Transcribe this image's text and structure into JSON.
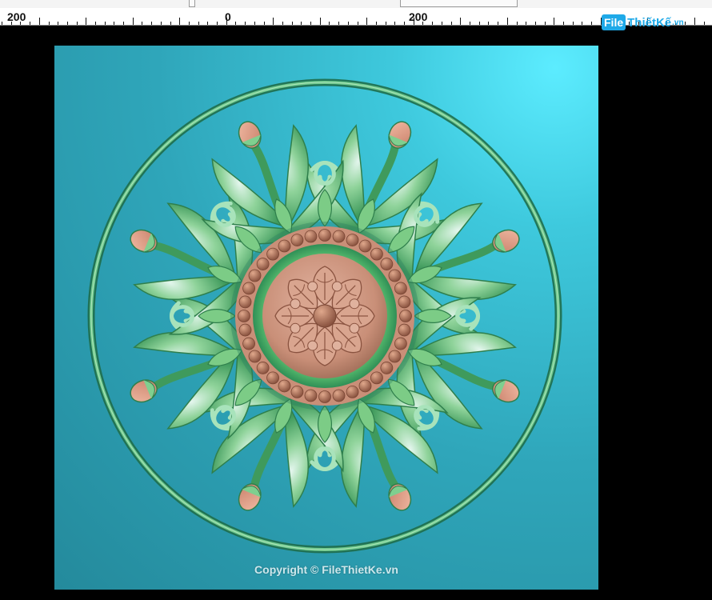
{
  "ruler": {
    "labels": [
      "200",
      "0",
      "200"
    ]
  },
  "logo": {
    "part1": "File",
    "part2": "ThiếtKế",
    "part3": ".vn"
  },
  "canvas": {
    "copyright": "Copyright © FileThietKe.vn",
    "colors": {
      "background_light": "#5cecff",
      "background_dark": "#248a9c",
      "ring": "#2e8f62",
      "leaf_green": "#6cc77c",
      "leaf_light": "#d6efe6",
      "center_pink": "#c98f78",
      "bead": "#b5775c"
    }
  },
  "icons": [
    "medallion-carving"
  ]
}
